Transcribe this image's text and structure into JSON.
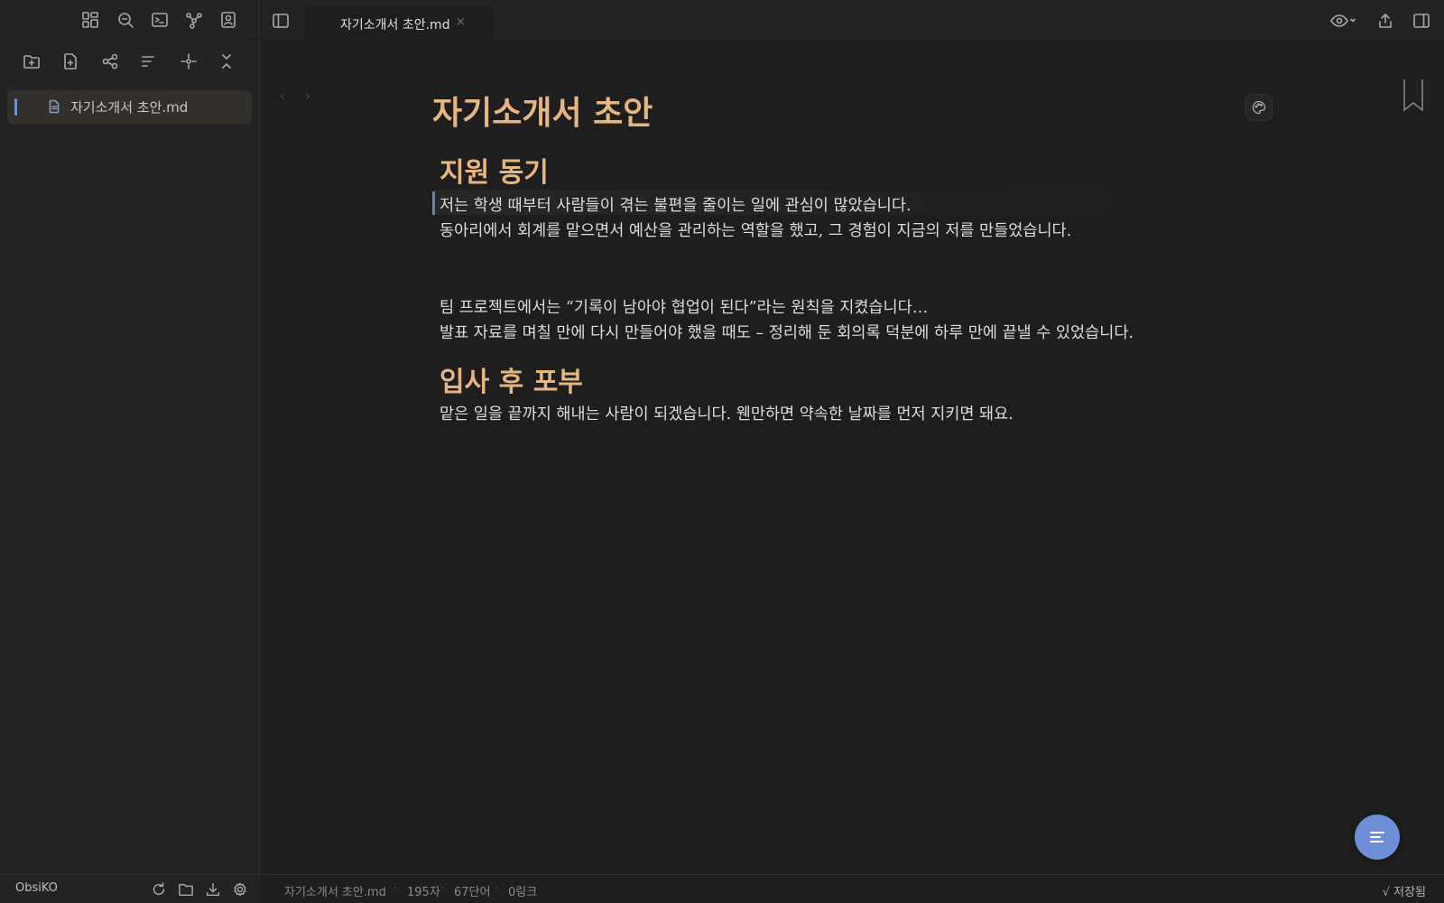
{
  "sidebar": {
    "ribbon_icons": [
      "layout-grid-icon",
      "search-icon",
      "terminal-icon",
      "graph-icon",
      "contacts-icon"
    ],
    "toolbar_icons": [
      "new-folder-icon",
      "new-note-icon",
      "structure-icon",
      "sort-icon",
      "locate-icon",
      "collapse-icon"
    ],
    "files": [
      {
        "label": "자기소개서 초안.md",
        "icon": "document-icon",
        "active": true
      }
    ],
    "footer": {
      "vault_name": "ObsiKO",
      "icons": [
        "refresh-icon",
        "folder-icon",
        "download-icon",
        "settings-icon"
      ]
    }
  },
  "tabbar": {
    "active_tab": "자기소개서 초안.md",
    "close_glyph": "×",
    "right_icons": [
      "eye-icon",
      "share-icon",
      "right-panel-icon"
    ]
  },
  "nav": {
    "back": "‹",
    "forward": "›"
  },
  "document": {
    "title": "자기소개서 초안",
    "sections": [
      {
        "heading": "지원 동기",
        "lines": [
          "저는 학생 때부터 사람들이 겪는 불편을 줄이는 일에 관심이 많았습니다.",
          "동아리에서 회계를 맡으면서 예산을 관리하는 역할을 했고, 그 경험이 지금의 저를 만들었습니다."
        ]
      },
      {
        "heading": "",
        "lines": [
          "팀 프로젝트에서는 “기록이 남아야 협업이 된다”라는 원칙을 지켰습니다…",
          "발표 자료를 며칠 만에 다시 만들어야 했을 때도 – 정리해 둔 회의록 덕분에 하루 만에 끝낼 수 있었습니다."
        ]
      },
      {
        "heading": "입사 후 포부",
        "lines": [
          "맡은 일을 끝까지 해내는 사람이 되겠습니다. 웬만하면 약속한 날짜를 먼저 지키면 돼요."
        ]
      }
    ]
  },
  "statusbar": {
    "filename": "자기소개서 초안.md",
    "chars": "195자",
    "words": "67단어",
    "links": "0링크",
    "saved": "√ 저장됨"
  },
  "colors": {
    "accent": "#6e8fd8",
    "heading": "#e5b582",
    "background": "#1e1e1e",
    "sidebar": "#232323"
  }
}
